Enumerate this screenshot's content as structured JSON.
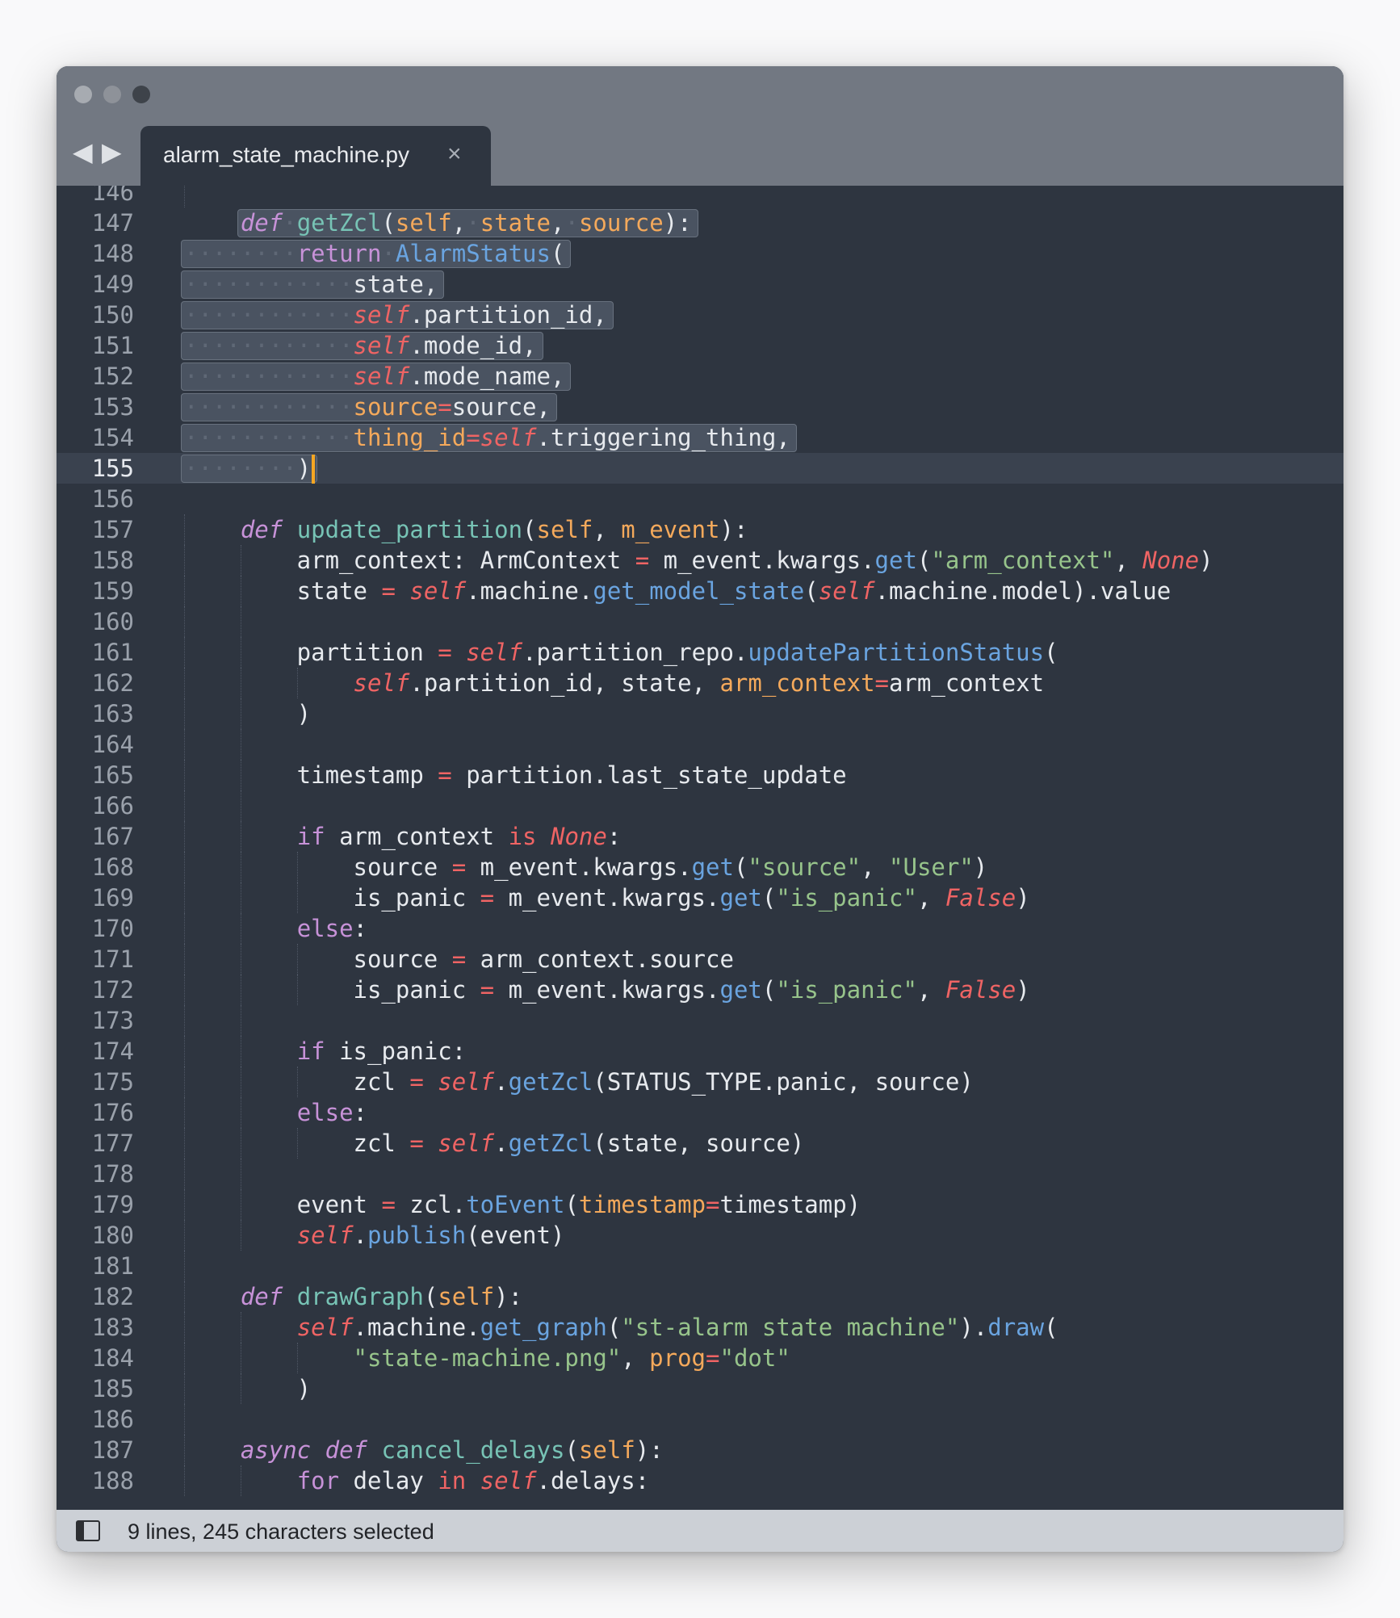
{
  "window": {
    "tab": {
      "title": "alarm_state_machine.py",
      "close_glyph": "×"
    },
    "nav": {
      "back_glyph": "◀",
      "forward_glyph": "▶"
    }
  },
  "editor": {
    "language": "python",
    "current_line": 155,
    "lines": [
      {
        "n": 146,
        "tokens": []
      },
      {
        "n": 147,
        "tokens": [
          [
            "def",
            "def"
          ],
          [
            "ws",
            "·"
          ],
          [
            "fn",
            "getZcl"
          ],
          [
            "pl",
            "("
          ],
          [
            "param",
            "self"
          ],
          [
            "pl",
            ","
          ],
          [
            "ws",
            "·"
          ],
          [
            "param",
            "state"
          ],
          [
            "pl",
            ","
          ],
          [
            "ws",
            "·"
          ],
          [
            "param",
            "source"
          ],
          [
            "pl",
            "):"
          ]
        ]
      },
      {
        "n": 148,
        "tokens": [
          [
            "ws",
            "········"
          ],
          [
            "kw",
            "return"
          ],
          [
            "ws",
            "·"
          ],
          [
            "cls",
            "AlarmStatus"
          ],
          [
            "pl",
            "("
          ]
        ]
      },
      {
        "n": 149,
        "tokens": [
          [
            "ws",
            "············"
          ],
          [
            "pl",
            "state,"
          ]
        ]
      },
      {
        "n": 150,
        "tokens": [
          [
            "ws",
            "············"
          ],
          [
            "selfk",
            "self"
          ],
          [
            "pl",
            ".partition_id,"
          ]
        ]
      },
      {
        "n": 151,
        "tokens": [
          [
            "ws",
            "············"
          ],
          [
            "selfk",
            "self"
          ],
          [
            "pl",
            ".mode_id,"
          ]
        ]
      },
      {
        "n": 152,
        "tokens": [
          [
            "ws",
            "············"
          ],
          [
            "selfk",
            "self"
          ],
          [
            "pl",
            ".mode_name,"
          ]
        ]
      },
      {
        "n": 153,
        "tokens": [
          [
            "ws",
            "············"
          ],
          [
            "kwarg",
            "source"
          ],
          [
            "op",
            "="
          ],
          [
            "pl",
            "source,"
          ]
        ]
      },
      {
        "n": 154,
        "tokens": [
          [
            "ws",
            "············"
          ],
          [
            "kwarg",
            "thing_id"
          ],
          [
            "op",
            "="
          ],
          [
            "selfk",
            "self"
          ],
          [
            "pl",
            ".triggering_thing,"
          ]
        ]
      },
      {
        "n": 155,
        "tokens": [
          [
            "ws",
            "········"
          ],
          [
            "pl",
            ")"
          ]
        ]
      },
      {
        "n": 156,
        "tokens": []
      },
      {
        "n": 157,
        "tokens": [
          [
            "pl",
            "    "
          ],
          [
            "def",
            "def"
          ],
          [
            "pl",
            " "
          ],
          [
            "fn",
            "update_partition"
          ],
          [
            "pl",
            "("
          ],
          [
            "param",
            "self"
          ],
          [
            "pl",
            ", "
          ],
          [
            "param",
            "m_event"
          ],
          [
            "pl",
            "):"
          ]
        ]
      },
      {
        "n": 158,
        "tokens": [
          [
            "pl",
            "        arm_context: ArmContext "
          ],
          [
            "op",
            "="
          ],
          [
            "pl",
            " m_event.kwargs."
          ],
          [
            "meth",
            "get"
          ],
          [
            "pl",
            "("
          ],
          [
            "str",
            "\"arm_context\""
          ],
          [
            "pl",
            ", "
          ],
          [
            "const",
            "None"
          ],
          [
            "pl",
            ")"
          ]
        ]
      },
      {
        "n": 159,
        "tokens": [
          [
            "pl",
            "        state "
          ],
          [
            "op",
            "="
          ],
          [
            "pl",
            " "
          ],
          [
            "selfk",
            "self"
          ],
          [
            "pl",
            ".machine."
          ],
          [
            "meth",
            "get_model_state"
          ],
          [
            "pl",
            "("
          ],
          [
            "selfk",
            "self"
          ],
          [
            "pl",
            ".machine.model).value"
          ]
        ]
      },
      {
        "n": 160,
        "tokens": []
      },
      {
        "n": 161,
        "tokens": [
          [
            "pl",
            "        partition "
          ],
          [
            "op",
            "="
          ],
          [
            "pl",
            " "
          ],
          [
            "selfk",
            "self"
          ],
          [
            "pl",
            ".partition_repo."
          ],
          [
            "meth",
            "updatePartitionStatus"
          ],
          [
            "pl",
            "("
          ]
        ]
      },
      {
        "n": 162,
        "tokens": [
          [
            "pl",
            "            "
          ],
          [
            "selfk",
            "self"
          ],
          [
            "pl",
            ".partition_id, state, "
          ],
          [
            "kwarg",
            "arm_context"
          ],
          [
            "op",
            "="
          ],
          [
            "pl",
            "arm_context"
          ]
        ]
      },
      {
        "n": 163,
        "tokens": [
          [
            "pl",
            "        )"
          ]
        ]
      },
      {
        "n": 164,
        "tokens": []
      },
      {
        "n": 165,
        "tokens": [
          [
            "pl",
            "        timestamp "
          ],
          [
            "op",
            "="
          ],
          [
            "pl",
            " partition.last_state_update"
          ]
        ]
      },
      {
        "n": 166,
        "tokens": []
      },
      {
        "n": 167,
        "tokens": [
          [
            "pl",
            "        "
          ],
          [
            "kw",
            "if"
          ],
          [
            "pl",
            " arm_context "
          ],
          [
            "op",
            "is"
          ],
          [
            "pl",
            " "
          ],
          [
            "const",
            "None"
          ],
          [
            "pl",
            ":"
          ]
        ]
      },
      {
        "n": 168,
        "tokens": [
          [
            "pl",
            "            source "
          ],
          [
            "op",
            "="
          ],
          [
            "pl",
            " m_event.kwargs."
          ],
          [
            "meth",
            "get"
          ],
          [
            "pl",
            "("
          ],
          [
            "str",
            "\"source\""
          ],
          [
            "pl",
            ", "
          ],
          [
            "str",
            "\"User\""
          ],
          [
            "pl",
            ")"
          ]
        ]
      },
      {
        "n": 169,
        "tokens": [
          [
            "pl",
            "            is_panic "
          ],
          [
            "op",
            "="
          ],
          [
            "pl",
            " m_event.kwargs."
          ],
          [
            "meth",
            "get"
          ],
          [
            "pl",
            "("
          ],
          [
            "str",
            "\"is_panic\""
          ],
          [
            "pl",
            ", "
          ],
          [
            "const",
            "False"
          ],
          [
            "pl",
            ")"
          ]
        ]
      },
      {
        "n": 170,
        "tokens": [
          [
            "pl",
            "        "
          ],
          [
            "kw",
            "else"
          ],
          [
            "pl",
            ":"
          ]
        ]
      },
      {
        "n": 171,
        "tokens": [
          [
            "pl",
            "            source "
          ],
          [
            "op",
            "="
          ],
          [
            "pl",
            " arm_context.source"
          ]
        ]
      },
      {
        "n": 172,
        "tokens": [
          [
            "pl",
            "            is_panic "
          ],
          [
            "op",
            "="
          ],
          [
            "pl",
            " m_event.kwargs."
          ],
          [
            "meth",
            "get"
          ],
          [
            "pl",
            "("
          ],
          [
            "str",
            "\"is_panic\""
          ],
          [
            "pl",
            ", "
          ],
          [
            "const",
            "False"
          ],
          [
            "pl",
            ")"
          ]
        ]
      },
      {
        "n": 173,
        "tokens": []
      },
      {
        "n": 174,
        "tokens": [
          [
            "pl",
            "        "
          ],
          [
            "kw",
            "if"
          ],
          [
            "pl",
            " is_panic:"
          ]
        ]
      },
      {
        "n": 175,
        "tokens": [
          [
            "pl",
            "            zcl "
          ],
          [
            "op",
            "="
          ],
          [
            "pl",
            " "
          ],
          [
            "selfk",
            "self"
          ],
          [
            "pl",
            "."
          ],
          [
            "meth",
            "getZcl"
          ],
          [
            "pl",
            "(STATUS_TYPE.panic, source)"
          ]
        ]
      },
      {
        "n": 176,
        "tokens": [
          [
            "pl",
            "        "
          ],
          [
            "kw",
            "else"
          ],
          [
            "pl",
            ":"
          ]
        ]
      },
      {
        "n": 177,
        "tokens": [
          [
            "pl",
            "            zcl "
          ],
          [
            "op",
            "="
          ],
          [
            "pl",
            " "
          ],
          [
            "selfk",
            "self"
          ],
          [
            "pl",
            "."
          ],
          [
            "meth",
            "getZcl"
          ],
          [
            "pl",
            "(state, source)"
          ]
        ]
      },
      {
        "n": 178,
        "tokens": []
      },
      {
        "n": 179,
        "tokens": [
          [
            "pl",
            "        event "
          ],
          [
            "op",
            "="
          ],
          [
            "pl",
            " zcl."
          ],
          [
            "meth",
            "toEvent"
          ],
          [
            "pl",
            "("
          ],
          [
            "kwarg",
            "timestamp"
          ],
          [
            "op",
            "="
          ],
          [
            "pl",
            "timestamp)"
          ]
        ]
      },
      {
        "n": 180,
        "tokens": [
          [
            "pl",
            "        "
          ],
          [
            "selfk",
            "self"
          ],
          [
            "pl",
            "."
          ],
          [
            "meth",
            "publish"
          ],
          [
            "pl",
            "(event)"
          ]
        ]
      },
      {
        "n": 181,
        "tokens": []
      },
      {
        "n": 182,
        "tokens": [
          [
            "pl",
            "    "
          ],
          [
            "def",
            "def"
          ],
          [
            "pl",
            " "
          ],
          [
            "fn",
            "drawGraph"
          ],
          [
            "pl",
            "("
          ],
          [
            "param",
            "self"
          ],
          [
            "pl",
            "):"
          ]
        ]
      },
      {
        "n": 183,
        "tokens": [
          [
            "pl",
            "        "
          ],
          [
            "selfk",
            "self"
          ],
          [
            "pl",
            ".machine."
          ],
          [
            "meth",
            "get_graph"
          ],
          [
            "pl",
            "("
          ],
          [
            "str",
            "\"st-alarm state machine\""
          ],
          [
            "pl",
            ")."
          ],
          [
            "meth",
            "draw"
          ],
          [
            "pl",
            "("
          ]
        ]
      },
      {
        "n": 184,
        "tokens": [
          [
            "pl",
            "            "
          ],
          [
            "str",
            "\"state-machine.png\""
          ],
          [
            "pl",
            ", "
          ],
          [
            "kwarg",
            "prog"
          ],
          [
            "op",
            "="
          ],
          [
            "str",
            "\"dot\""
          ]
        ]
      },
      {
        "n": 185,
        "tokens": [
          [
            "pl",
            "        )"
          ]
        ]
      },
      {
        "n": 186,
        "tokens": []
      },
      {
        "n": 187,
        "tokens": [
          [
            "pl",
            "    "
          ],
          [
            "def",
            "async"
          ],
          [
            "pl",
            " "
          ],
          [
            "def",
            "def"
          ],
          [
            "pl",
            " "
          ],
          [
            "fn",
            "cancel_delays"
          ],
          [
            "pl",
            "("
          ],
          [
            "param",
            "self"
          ],
          [
            "pl",
            "):"
          ]
        ]
      },
      {
        "n": 188,
        "tokens": [
          [
            "pl",
            "        "
          ],
          [
            "kw",
            "for"
          ],
          [
            "pl",
            " delay "
          ],
          [
            "op",
            "in"
          ],
          [
            "pl",
            " "
          ],
          [
            "selfk",
            "self"
          ],
          [
            "pl",
            ".delays:"
          ]
        ]
      }
    ]
  },
  "statusbar": {
    "text": "9 lines, 245 characters selected"
  },
  "colors": {
    "editor_bg": "#2e3540",
    "titlebar_bg": "#727882",
    "selection": "#4a5361",
    "caret": "#f5a623",
    "statusbar_bg": "#ccd0d6"
  }
}
